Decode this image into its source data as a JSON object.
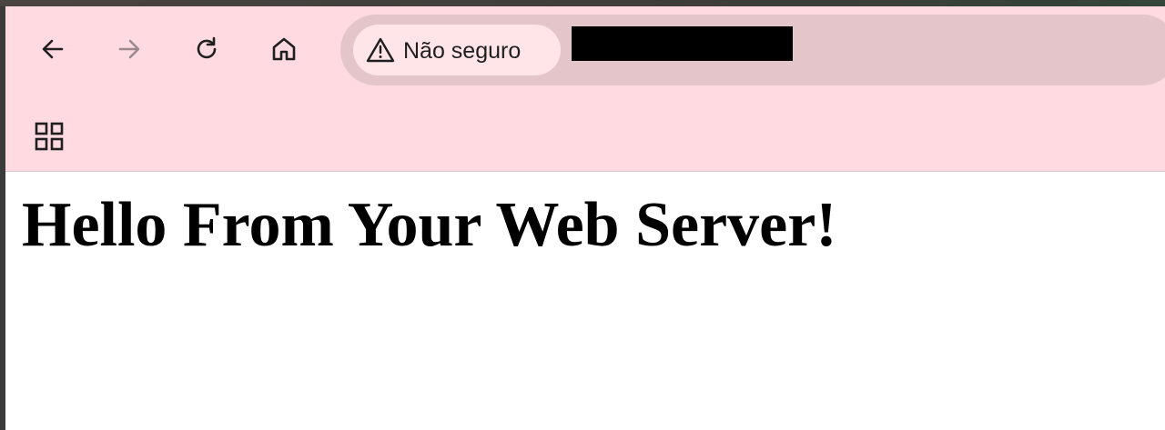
{
  "browser": {
    "security_label": "Não seguro",
    "url_redacted": true,
    "colors": {
      "toolbar": "#ffdbe1",
      "omnibox": "#e4c5ca",
      "chip": "#ffe4e8",
      "disabled_icon": "#9a8a8d",
      "icon": "#1f1f1f"
    },
    "nav": {
      "back": "arrow-left-icon",
      "forward": "arrow-right-icon",
      "reload": "reload-icon",
      "home": "home-icon"
    },
    "bookmarks": {
      "apps": "apps-grid-icon"
    }
  },
  "page": {
    "heading": "Hello From Your Web Server!"
  }
}
